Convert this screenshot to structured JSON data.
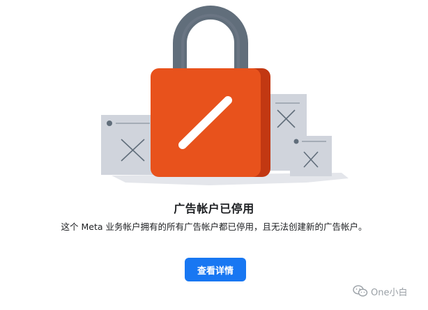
{
  "dialog": {
    "title": "广告帐户已停用",
    "description": "这个 Meta 业务帐户拥有的所有广告帐户都已停用，且无法创建新的广告帐户。",
    "button_label": "查看详情"
  },
  "watermark": {
    "text": "One小白",
    "icon": "wechat-icon"
  },
  "colors": {
    "lock_body": "#e8521c",
    "lock_shackle": "#616e7b",
    "button": "#1877f2",
    "window_cards": "#d0d4dc"
  },
  "icons": [
    "lock-icon",
    "window-card-icon",
    "close-x-icon",
    "wechat-icon"
  ]
}
